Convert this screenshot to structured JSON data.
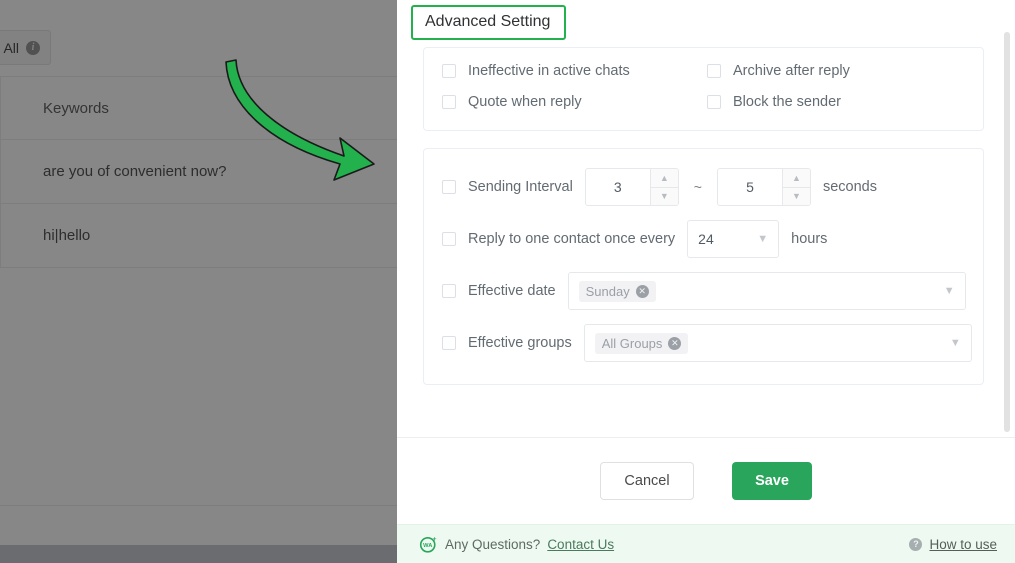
{
  "background": {
    "tab_label": "All",
    "info_icon": "info-icon",
    "table": {
      "header": "Keywords",
      "rows": [
        "are you of convenient now?",
        "hi|hello"
      ]
    }
  },
  "annotation": {
    "arrow_color": "#22b14c",
    "shape": "curved-arrow-down-right"
  },
  "modal": {
    "title": "Advanced Setting",
    "title_highlight_color": "#22b14c",
    "checkbox_options": [
      {
        "label": "Ineffective in active chats",
        "checked": false
      },
      {
        "label": "Archive after reply",
        "checked": false
      },
      {
        "label": "Quote when reply",
        "checked": false
      },
      {
        "label": "Block the sender",
        "checked": false
      }
    ],
    "sending_interval": {
      "label": "Sending Interval",
      "checked": false,
      "from": "3",
      "separator": "~",
      "to": "5",
      "unit": "seconds"
    },
    "reply_once": {
      "label": "Reply to one contact once every",
      "checked": false,
      "value": "24",
      "unit": "hours"
    },
    "effective_date": {
      "label": "Effective date",
      "checked": false,
      "tags": [
        "Sunday"
      ]
    },
    "effective_groups": {
      "label": "Effective groups",
      "checked": false,
      "tags": [
        "All Groups"
      ]
    },
    "buttons": {
      "cancel": "Cancel",
      "save": "Save",
      "save_color": "#2aa65c"
    },
    "help_footer": {
      "logo": "wa-plus-logo-icon",
      "question_text": "Any Questions?",
      "contact_link": "Contact Us",
      "help_icon": "question-mark-icon",
      "how_to_use_link": "How to use"
    }
  }
}
